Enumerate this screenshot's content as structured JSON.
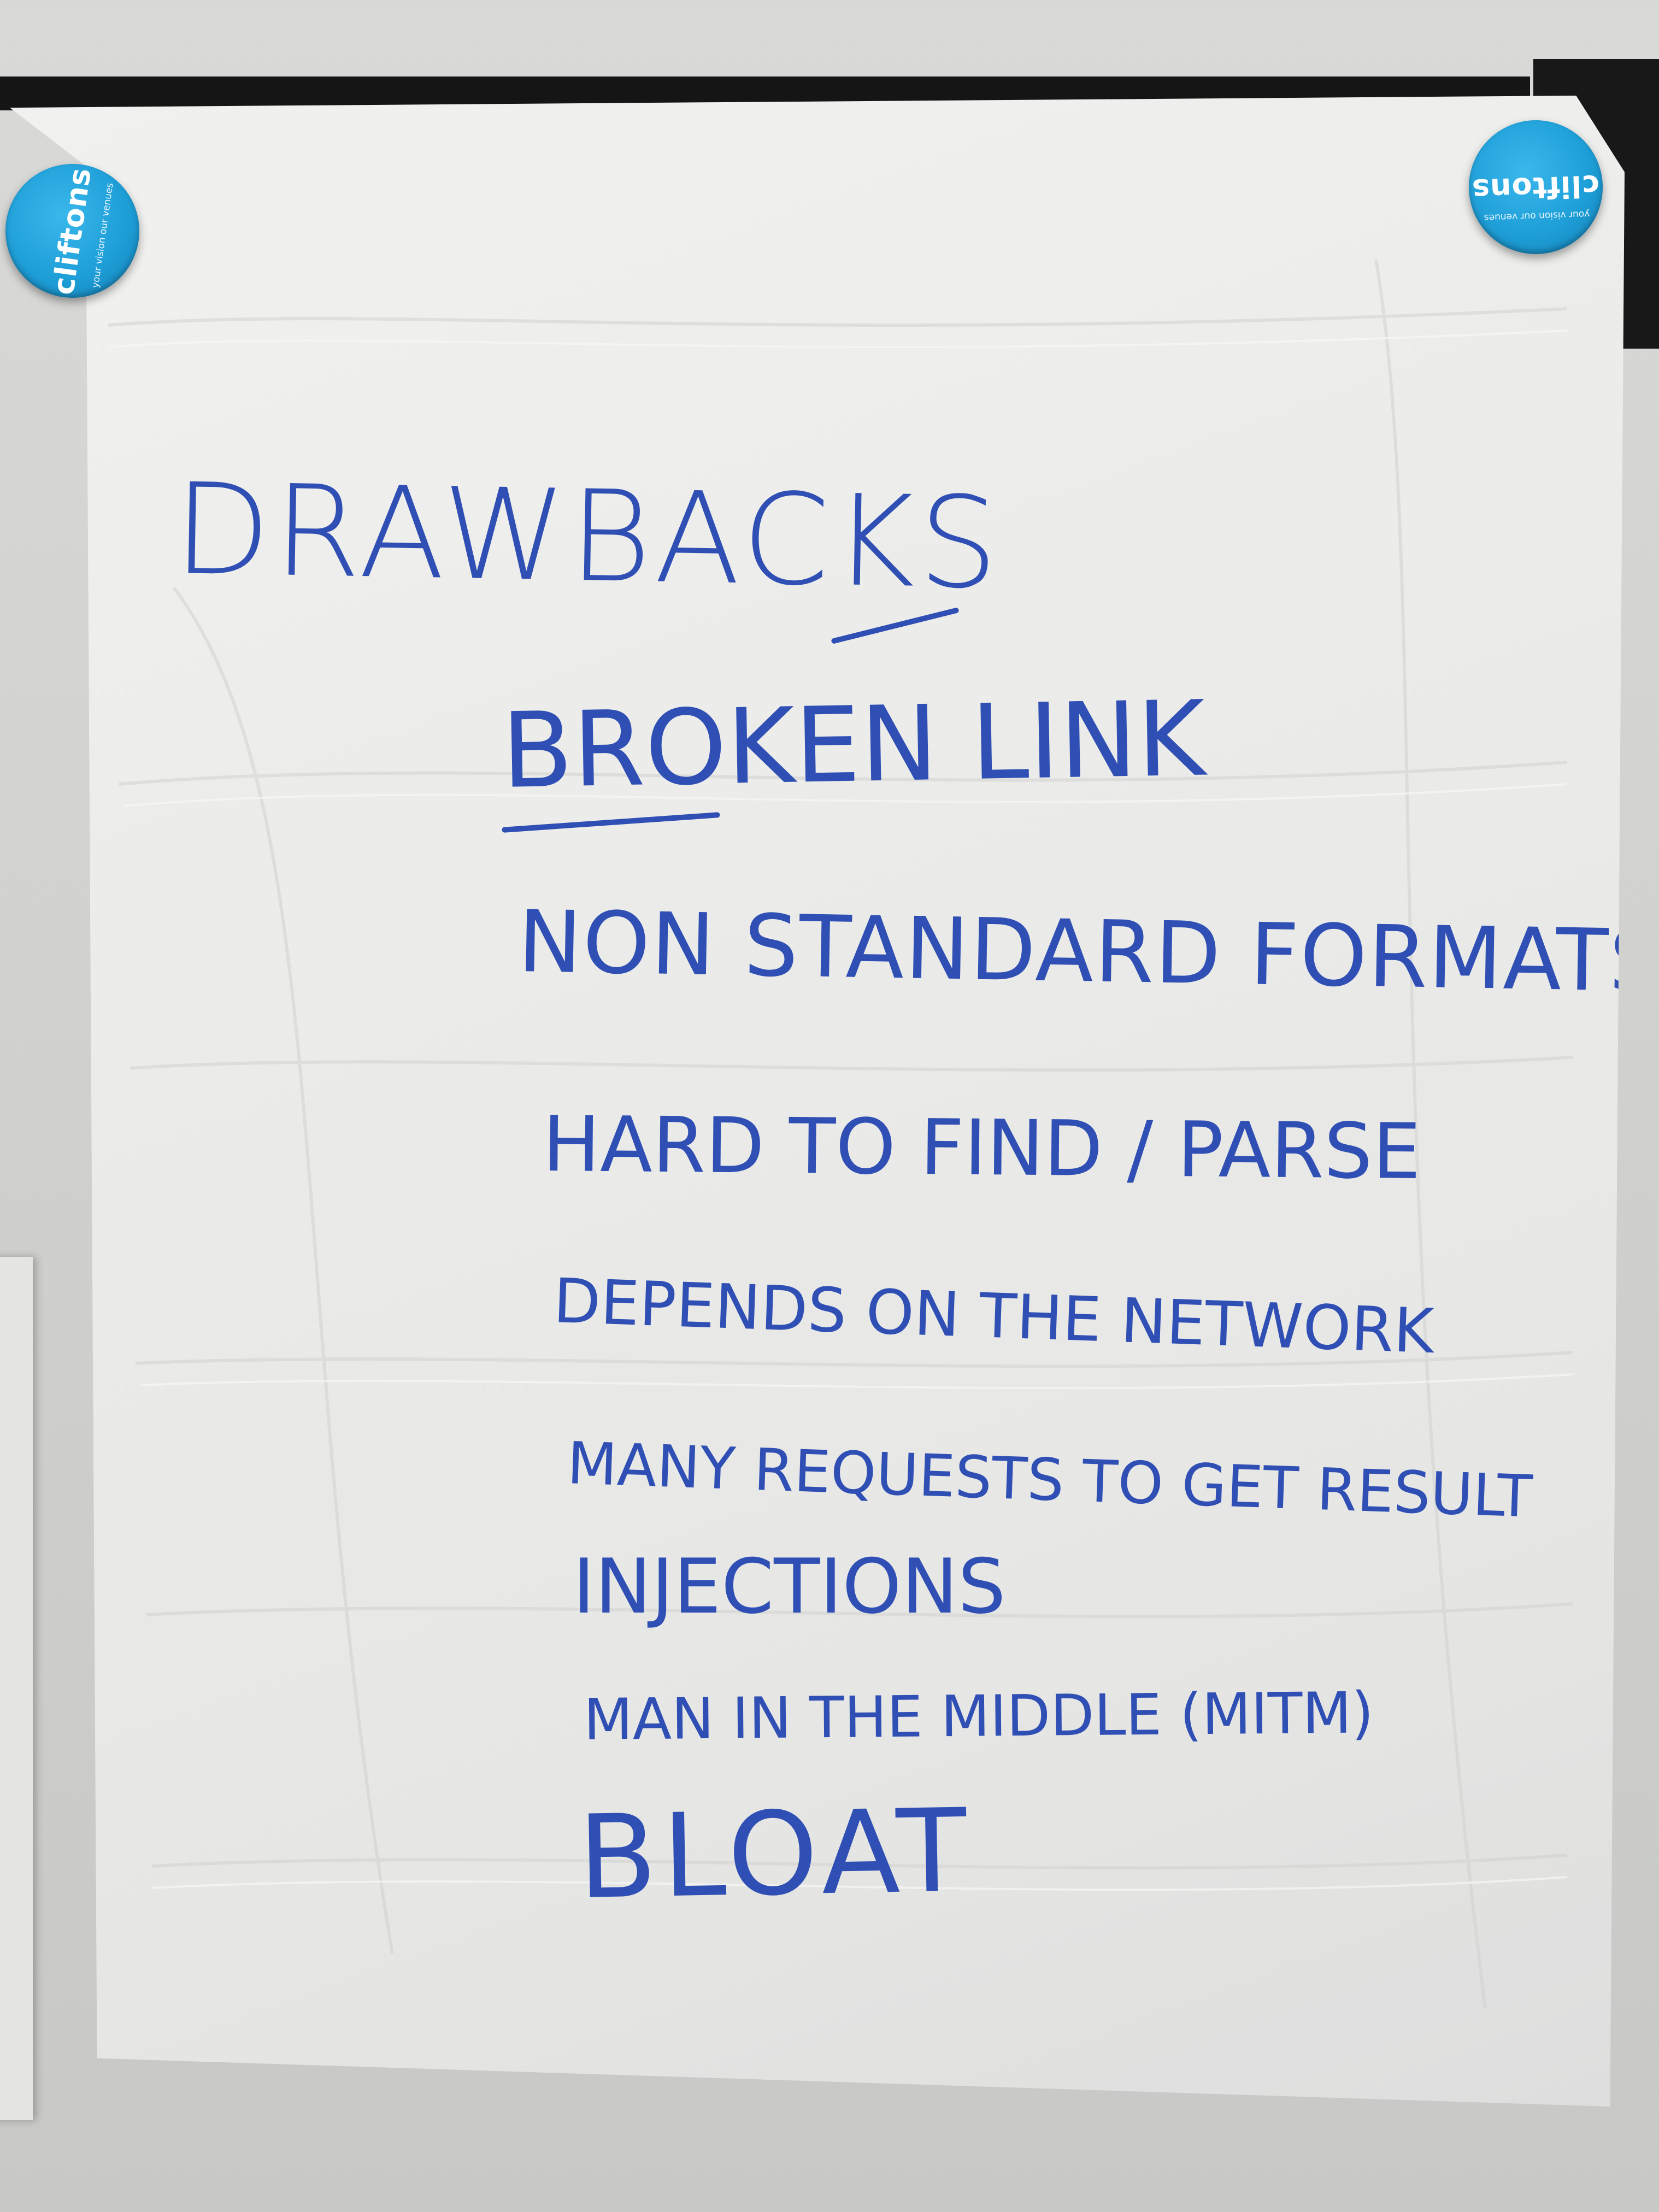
{
  "magnets": [
    {
      "brand": "cliftons",
      "tagline": "your vision our venues"
    },
    {
      "brand": "cliftons",
      "tagline": "your vision our venues"
    }
  ],
  "chart_sheet": {
    "title": "DRAWBACKS",
    "items": [
      "BROKEN LINK",
      "NON STANDARD FORMATS",
      "HARD TO FIND / PARSE",
      "DEPENDS ON THE NETWORK",
      "MANY REQUESTS TO GET RESULT",
      "INJECTIONS",
      "MAN IN THE MIDDLE (MITM)",
      "BLOAT"
    ]
  },
  "colors": {
    "marker_ink": "#2f4fb4",
    "magnet_blue": "#1f9fd8",
    "rail_black": "#151515",
    "paper": "#ececea"
  }
}
